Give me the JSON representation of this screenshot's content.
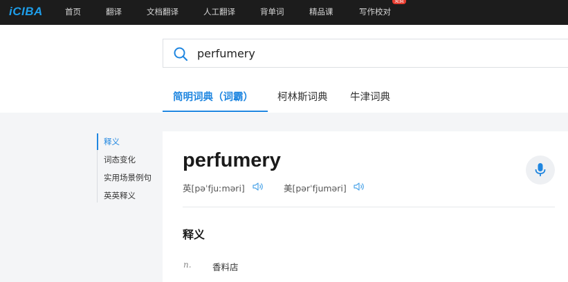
{
  "topnav": {
    "logo": "iCIBA",
    "items": [
      "首页",
      "翻译",
      "文档翻译",
      "人工翻译",
      "背单词",
      "精品课",
      "写作校对"
    ],
    "badge": "免费"
  },
  "search": {
    "value": "perfumery",
    "placeholder": ""
  },
  "dict_tabs": [
    "简明词典（词霸）",
    "柯林斯词典",
    "牛津词典"
  ],
  "sidemenu": {
    "items": [
      "释义",
      "词态变化",
      "实用场景例句",
      "英英释义"
    ]
  },
  "entry": {
    "word": "perfumery",
    "uk_phonetic": "英[pəˈfjuːməri]",
    "us_phonetic": "美[pərˈfjuməri]",
    "section_title": "释义",
    "definitions": [
      {
        "pos": "n.",
        "meaning": "香料店"
      }
    ]
  },
  "colors": {
    "accent": "#1f86e0",
    "nav_bg": "#1c1c1c",
    "badge": "#e63b2e"
  }
}
